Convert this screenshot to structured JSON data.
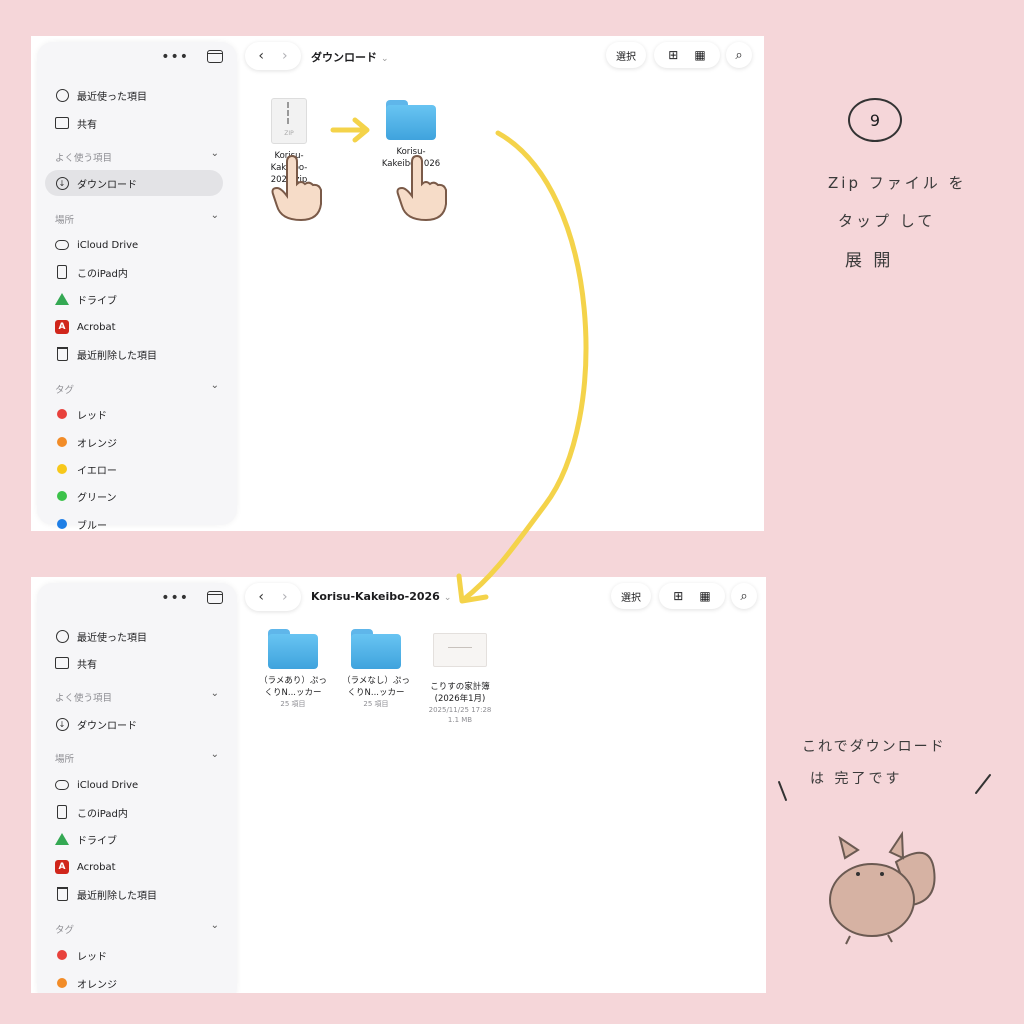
{
  "sidebar": {
    "recents": "最近使った項目",
    "shared": "共有",
    "favorites_header": "よく使う項目",
    "downloads": "ダウンロード",
    "locations_header": "場所",
    "icloud": "iCloud Drive",
    "on_ipad": "このiPad内",
    "gdrive": "ドライブ",
    "acrobat": "Acrobat",
    "recently_deleted": "最近削除した項目",
    "tags_header": "タグ",
    "tags": [
      {
        "label": "レッド",
        "color": "#e8413c"
      },
      {
        "label": "オレンジ",
        "color": "#f28c28"
      },
      {
        "label": "イエロー",
        "color": "#f7c81b"
      },
      {
        "label": "グリーン",
        "color": "#3cc24a"
      },
      {
        "label": "ブルー",
        "color": "#1f7fe6"
      }
    ]
  },
  "toolbar": {
    "select_label": "選択",
    "back_icon": "chevron-left-icon",
    "forward_icon": "chevron-right-icon"
  },
  "screen1": {
    "path_title": "ダウンロード",
    "files": [
      {
        "name_line1": "Korisu-",
        "name_line2": "Kakeibo-2026.zip",
        "type": "zip"
      },
      {
        "name_line1": "Korisu-",
        "name_line2": "Kakeibo-2026",
        "type": "folder"
      }
    ]
  },
  "screen2": {
    "path_title": "Korisu-Kakeibo-2026",
    "files": [
      {
        "name_line1": "（ラメあり）ぷっ",
        "name_line2": "くりN...ッカー",
        "meta1": "25 項目",
        "meta2": "",
        "type": "folder"
      },
      {
        "name_line1": "（ラメなし）ぷっ",
        "name_line2": "くりN...ッカー",
        "meta1": "25 項目",
        "meta2": "",
        "type": "folder"
      },
      {
        "name_line1": "こりすの家計簿",
        "name_line2": "(2026年1月)",
        "meta1": "2025/11/25 17:28",
        "meta2": "1.1 MB",
        "type": "document"
      }
    ]
  },
  "annotations": {
    "step_number": "9",
    "instruction_line1": "Zip ファイル を",
    "instruction_line2": "タップ して",
    "instruction_line3": "展 開",
    "done_line1": "これでダウンロード",
    "done_line2": "は 完了です"
  },
  "colors": {
    "background": "#f5d6d9",
    "arrow": "#f4d34a",
    "folder": "#4fb3ea"
  }
}
